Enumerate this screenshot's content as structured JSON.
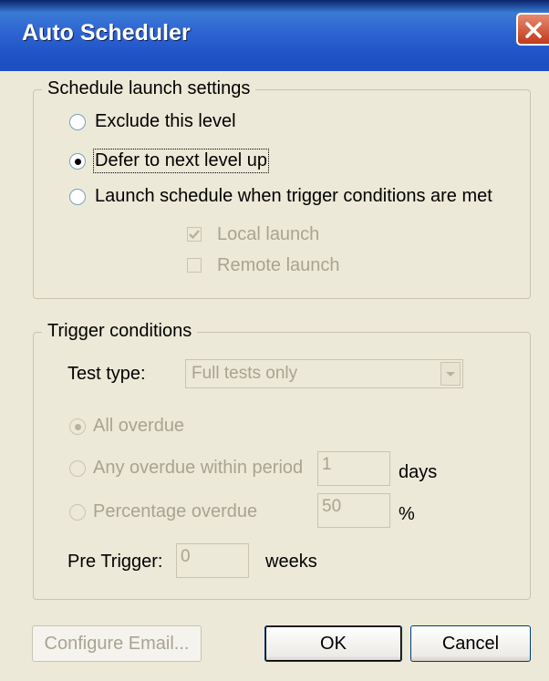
{
  "window": {
    "title": "Auto Scheduler"
  },
  "schedule_group": {
    "label": "Schedule launch settings",
    "options": [
      {
        "label": "Exclude this level",
        "selected": false
      },
      {
        "label": "Defer to next level up",
        "selected": true
      },
      {
        "label": "Launch schedule when trigger conditions are met",
        "selected": false
      }
    ],
    "local_launch": {
      "label": "Local launch",
      "checked": true,
      "enabled": false
    },
    "remote_launch": {
      "label": "Remote launch",
      "checked": false,
      "enabled": false
    }
  },
  "trigger_group": {
    "label": "Trigger conditions",
    "test_type_label": "Test type:",
    "test_type_value": "Full tests only",
    "options": [
      {
        "label": "All overdue",
        "selected": true
      },
      {
        "label": "Any overdue within period",
        "selected": false
      },
      {
        "label": "Percentage overdue",
        "selected": false
      }
    ],
    "period_value": "1",
    "period_unit": "days",
    "percentage_value": "50",
    "percentage_unit": "%",
    "pre_trigger_label": "Pre Trigger:",
    "pre_trigger_value": "0",
    "pre_trigger_unit": "weeks"
  },
  "buttons": {
    "configure_email": "Configure Email...",
    "ok": "OK",
    "cancel": "Cancel"
  },
  "colors": {
    "titlebar": "#2e64d2",
    "window_bg": "#ece9d8",
    "disabled_text": "#a9a391",
    "close_button": "#c2391b"
  }
}
